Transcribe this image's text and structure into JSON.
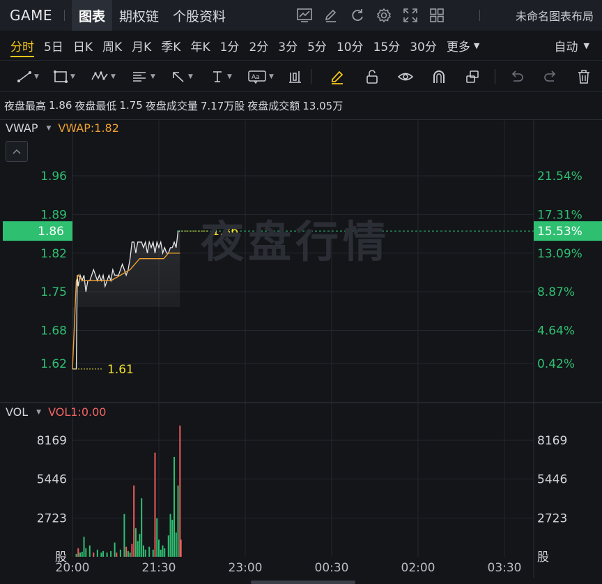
{
  "topbar": {
    "ticker": "GAME",
    "tabs": [
      "图表",
      "期权链",
      "个股资料"
    ],
    "active_tab": 0,
    "icons": [
      "trend-chart-icon",
      "pen-edit-icon",
      "refresh-icon",
      "settings-gear-icon",
      "fullscreen-icon",
      "grid-layout-icon"
    ],
    "layout_name": "未命名图表布局"
  },
  "periods": {
    "items": [
      "分时",
      "5日",
      "日K",
      "周K",
      "月K",
      "季K",
      "年K",
      "1分",
      "2分",
      "3分",
      "5分",
      "10分",
      "15分",
      "30分",
      "更多"
    ],
    "active": 0,
    "auto_label": "自动"
  },
  "tools": [
    "trend-line-icon",
    "rectangle-icon",
    "wave-pattern-icon",
    "fibonacci-icon",
    "arrow-icon",
    "text-cursor-icon",
    "text-annotation-icon",
    "bar-pattern-icon",
    "highlighter-icon",
    "lock-icon",
    "eye-icon",
    "magnet-icon",
    "copy-icon",
    "undo-icon",
    "redo-icon",
    "trash-icon"
  ],
  "stats": {
    "high_label": "夜盘最高",
    "high": "1.86",
    "low_label": "夜盘最低",
    "low": "1.75",
    "vol_label": "夜盘成交量",
    "vol": "7.17万股",
    "amt_label": "夜盘成交额",
    "amt": "13.05万"
  },
  "watermark": "夜盘行情",
  "vwap_indicator": {
    "name": "VWAP",
    "value": "VWAP:1.82"
  },
  "vol_indicator": {
    "name": "VOL",
    "value": "VOL1:0.00"
  },
  "colors": {
    "up": "#ef5c5c",
    "down": "#2fbf71",
    "vwap": "#f0a030",
    "price": "#e8e8e8",
    "last_price_bg": "#2fbf71",
    "axis_pct": "#2fbf71",
    "yellow": "#f5e030"
  },
  "chart_data": [
    {
      "type": "line",
      "time_ticks": [
        "20:00",
        "21:30",
        "23:00",
        "00:30",
        "02:00",
        "03:30"
      ],
      "price_ticks": [
        "1.96",
        "1.89",
        "1.82",
        "1.75",
        "1.68",
        "1.62"
      ],
      "pct_ticks": [
        "21.54%",
        "17.31%",
        "13.09%",
        "8.87%",
        "4.64%",
        "0.42%"
      ],
      "ylim": [
        1.56,
        2.03
      ],
      "last_price": "1.86",
      "last_pct": "15.53%",
      "high_marker": "1.86",
      "low_marker": "1.61",
      "series": [
        {
          "name": "VWAP",
          "minutes": [
            0,
            4,
            6,
            10,
            18,
            25,
            32,
            40,
            50,
            60,
            65,
            70,
            78,
            86,
            90,
            95,
            100,
            106,
            112
          ],
          "values": [
            1.61,
            1.77,
            1.78,
            1.77,
            1.77,
            1.77,
            1.77,
            1.77,
            1.78,
            1.79,
            1.8,
            1.81,
            1.81,
            1.81,
            1.81,
            1.81,
            1.82,
            1.82,
            1.82
          ]
        },
        {
          "minutes": [
            0,
            4,
            5,
            6,
            7,
            8,
            10,
            12,
            14,
            16,
            18,
            20,
            22,
            24,
            26,
            28,
            30,
            32,
            34,
            36,
            38,
            40,
            42,
            44,
            46,
            48,
            50,
            52,
            54,
            56,
            58,
            60,
            62,
            64,
            66,
            68,
            70,
            72,
            74,
            76,
            78,
            80,
            82,
            84,
            86,
            88,
            90,
            92,
            94,
            96,
            98,
            100,
            102,
            104,
            106,
            108,
            110,
            112
          ],
          "values": [
            1.61,
            1.61,
            1.78,
            1.76,
            1.77,
            1.78,
            1.77,
            1.78,
            1.75,
            1.77,
            1.77,
            1.78,
            1.79,
            1.78,
            1.77,
            1.78,
            1.77,
            1.78,
            1.76,
            1.77,
            1.78,
            1.77,
            1.79,
            1.78,
            1.78,
            1.78,
            1.79,
            1.8,
            1.79,
            1.78,
            1.79,
            1.81,
            1.84,
            1.84,
            1.82,
            1.84,
            1.84,
            1.84,
            1.83,
            1.84,
            1.82,
            1.84,
            1.83,
            1.84,
            1.82,
            1.84,
            1.83,
            1.84,
            1.82,
            1.83,
            1.82,
            1.82,
            1.83,
            1.83,
            1.84,
            1.83,
            1.86,
            1.86
          ]
        }
      ]
    },
    {
      "type": "bar",
      "vol_ticks": [
        "8169",
        "5446",
        "2723"
      ],
      "unit_label": "股",
      "ylim": [
        0,
        9600
      ],
      "bars": [
        {
          "m": 4,
          "v": 200,
          "up": false
        },
        {
          "m": 6,
          "v": 600,
          "up": true
        },
        {
          "m": 8,
          "v": 300,
          "up": false
        },
        {
          "m": 10,
          "v": 350,
          "up": false
        },
        {
          "m": 12,
          "v": 1400,
          "up": false
        },
        {
          "m": 14,
          "v": 600,
          "up": false
        },
        {
          "m": 18,
          "v": 800,
          "up": false
        },
        {
          "m": 22,
          "v": 300,
          "up": true
        },
        {
          "m": 26,
          "v": 500,
          "up": false
        },
        {
          "m": 30,
          "v": 300,
          "up": false
        },
        {
          "m": 32,
          "v": 400,
          "up": false
        },
        {
          "m": 36,
          "v": 300,
          "up": false
        },
        {
          "m": 40,
          "v": 400,
          "up": false
        },
        {
          "m": 44,
          "v": 1000,
          "up": false
        },
        {
          "m": 46,
          "v": 300,
          "up": true
        },
        {
          "m": 50,
          "v": 500,
          "up": false
        },
        {
          "m": 54,
          "v": 3000,
          "up": false
        },
        {
          "m": 56,
          "v": 700,
          "up": true
        },
        {
          "m": 58,
          "v": 400,
          "up": false
        },
        {
          "m": 60,
          "v": 300,
          "up": false
        },
        {
          "m": 62,
          "v": 900,
          "up": true
        },
        {
          "m": 64,
          "v": 5000,
          "up": true
        },
        {
          "m": 66,
          "v": 2000,
          "up": false
        },
        {
          "m": 68,
          "v": 1100,
          "up": false
        },
        {
          "m": 70,
          "v": 1600,
          "up": false
        },
        {
          "m": 72,
          "v": 4100,
          "up": false
        },
        {
          "m": 74,
          "v": 800,
          "up": false
        },
        {
          "m": 76,
          "v": 500,
          "up": false
        },
        {
          "m": 80,
          "v": 700,
          "up": false
        },
        {
          "m": 84,
          "v": 500,
          "up": false
        },
        {
          "m": 86,
          "v": 7300,
          "up": true
        },
        {
          "m": 88,
          "v": 2700,
          "up": false
        },
        {
          "m": 90,
          "v": 1200,
          "up": false
        },
        {
          "m": 92,
          "v": 500,
          "up": false
        },
        {
          "m": 94,
          "v": 800,
          "up": false
        },
        {
          "m": 96,
          "v": 600,
          "up": false
        },
        {
          "m": 100,
          "v": 1500,
          "up": false
        },
        {
          "m": 102,
          "v": 3000,
          "up": false
        },
        {
          "m": 104,
          "v": 2600,
          "up": false
        },
        {
          "m": 106,
          "v": 7000,
          "up": false
        },
        {
          "m": 108,
          "v": 1700,
          "up": false
        },
        {
          "m": 110,
          "v": 5000,
          "up": false
        },
        {
          "m": 112,
          "v": 9200,
          "up": true
        },
        {
          "m": 113,
          "v": 1200,
          "up": true
        }
      ]
    }
  ]
}
